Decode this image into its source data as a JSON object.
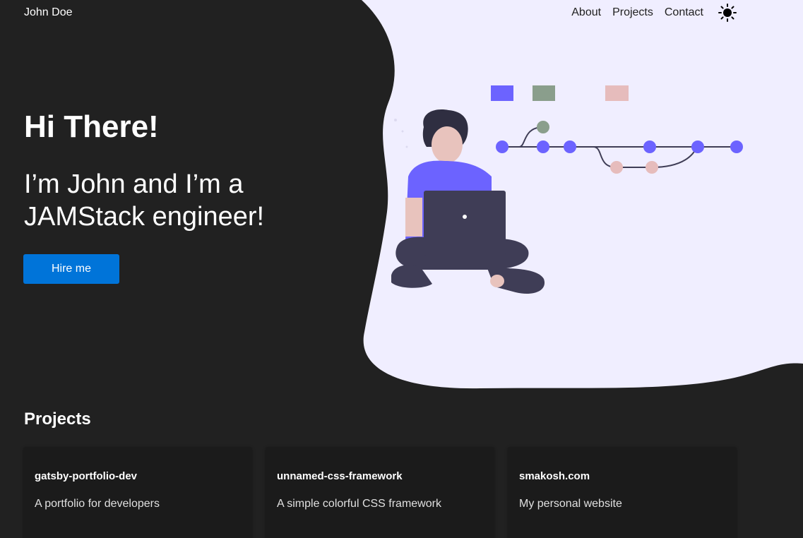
{
  "header": {
    "brand": "John Doe",
    "nav": [
      {
        "label": "About"
      },
      {
        "label": "Projects"
      },
      {
        "label": "Contact"
      }
    ],
    "theme_icon": "sun-icon"
  },
  "hero": {
    "title": "Hi There!",
    "subtitle": "I’m John and I’m a JAMStack engineer!",
    "cta": "Hire me"
  },
  "projects": {
    "title": "Projects",
    "items": [
      {
        "name": "gatsby-portfolio-dev",
        "description": "A portfolio for developers"
      },
      {
        "name": "unnamed-css-framework",
        "description": "A simple colorful CSS framework"
      },
      {
        "name": "smakosh.com",
        "description": "My personal website"
      }
    ]
  },
  "colors": {
    "background": "#212121",
    "blob": "#f0eeff",
    "accent": "#0074d9",
    "purple": "#6c63ff",
    "sage": "#8a9e8c",
    "pink": "#e6bcbc",
    "dark": "#3f3d56"
  }
}
